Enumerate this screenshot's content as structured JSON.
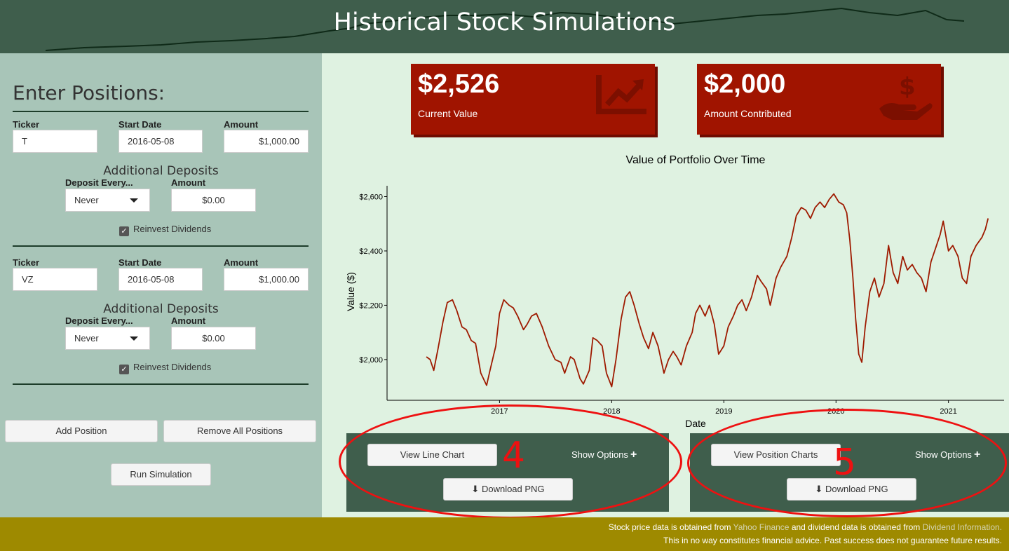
{
  "header": {
    "title": "Historical Stock Simulations"
  },
  "sidebar": {
    "heading": "Enter Positions:",
    "labels": {
      "ticker": "Ticker",
      "start_date": "Start Date",
      "amount": "Amount",
      "additional_deposits": "Additional Deposits",
      "deposit_every": "Deposit Every...",
      "deposit_amount": "Amount",
      "reinvest": "Reinvest Dividends"
    },
    "positions": [
      {
        "ticker": "T",
        "start_date": "2016-05-08",
        "amount": "$1,000.00",
        "deposit_every": "Never",
        "deposit_amount": "$0.00",
        "reinvest": true
      },
      {
        "ticker": "VZ",
        "start_date": "2016-05-08",
        "amount": "$1,000.00",
        "deposit_every": "Never",
        "deposit_amount": "$0.00",
        "reinvest": true
      }
    ],
    "add_position": "Add Position",
    "remove_all": "Remove All Positions",
    "run": "Run Simulation"
  },
  "value_boxes": [
    {
      "value": "$2,526",
      "caption": "Current Value",
      "icon": "chart-line-icon"
    },
    {
      "value": "$2,000",
      "caption": "Amount Contributed",
      "icon": "hand-holding-dollar-icon"
    }
  ],
  "chart_data": {
    "type": "line",
    "title": "Value of Portfolio Over Time",
    "xlabel": "Date",
    "ylabel": "Value ($)",
    "xticks": [
      "2017",
      "2018",
      "2019",
      "2020",
      "2021"
    ],
    "yticks": [
      "$2,000",
      "$2,200",
      "$2,400",
      "$2,600"
    ],
    "ylim": [
      1850,
      2640
    ],
    "xlim": [
      "2016-01-01",
      "2021-07-01"
    ],
    "color": "#9e1a00",
    "series": [
      {
        "points": [
          [
            "2016-05-08",
            2010
          ],
          [
            "2016-05-20",
            2000
          ],
          [
            "2016-06-01",
            1960
          ],
          [
            "2016-06-15",
            2040
          ],
          [
            "2016-07-01",
            2140
          ],
          [
            "2016-07-15",
            2210
          ],
          [
            "2016-08-01",
            2220
          ],
          [
            "2016-08-15",
            2180
          ],
          [
            "2016-09-01",
            2120
          ],
          [
            "2016-09-15",
            2110
          ],
          [
            "2016-10-01",
            2070
          ],
          [
            "2016-10-15",
            2060
          ],
          [
            "2016-11-01",
            1950
          ],
          [
            "2016-11-20",
            1905
          ],
          [
            "2016-12-01",
            1960
          ],
          [
            "2016-12-20",
            2050
          ],
          [
            "2017-01-01",
            2170
          ],
          [
            "2017-01-15",
            2220
          ],
          [
            "2017-02-01",
            2200
          ],
          [
            "2017-02-15",
            2190
          ],
          [
            "2017-03-01",
            2160
          ],
          [
            "2017-03-20",
            2110
          ],
          [
            "2017-04-01",
            2130
          ],
          [
            "2017-04-15",
            2160
          ],
          [
            "2017-05-01",
            2170
          ],
          [
            "2017-05-20",
            2120
          ],
          [
            "2017-06-10",
            2050
          ],
          [
            "2017-07-01",
            2000
          ],
          [
            "2017-07-20",
            1990
          ],
          [
            "2017-08-01",
            1950
          ],
          [
            "2017-08-20",
            2010
          ],
          [
            "2017-09-01",
            2000
          ],
          [
            "2017-09-20",
            1930
          ],
          [
            "2017-10-01",
            1910
          ],
          [
            "2017-10-20",
            1960
          ],
          [
            "2017-11-01",
            2080
          ],
          [
            "2017-11-15",
            2070
          ],
          [
            "2017-12-01",
            2050
          ],
          [
            "2017-12-15",
            1950
          ],
          [
            "2018-01-01",
            1900
          ],
          [
            "2018-01-15",
            2000
          ],
          [
            "2018-02-01",
            2150
          ],
          [
            "2018-02-15",
            2230
          ],
          [
            "2018-03-01",
            2250
          ],
          [
            "2018-03-15",
            2200
          ],
          [
            "2018-04-01",
            2130
          ],
          [
            "2018-04-15",
            2080
          ],
          [
            "2018-05-01",
            2040
          ],
          [
            "2018-05-15",
            2100
          ],
          [
            "2018-06-01",
            2050
          ],
          [
            "2018-06-20",
            1950
          ],
          [
            "2018-07-05",
            2000
          ],
          [
            "2018-07-20",
            2030
          ],
          [
            "2018-08-01",
            2010
          ],
          [
            "2018-08-15",
            1980
          ],
          [
            "2018-09-01",
            2050
          ],
          [
            "2018-09-20",
            2100
          ],
          [
            "2018-10-01",
            2170
          ],
          [
            "2018-10-15",
            2200
          ],
          [
            "2018-11-01",
            2160
          ],
          [
            "2018-11-15",
            2200
          ],
          [
            "2018-12-01",
            2130
          ],
          [
            "2018-12-15",
            2020
          ],
          [
            "2019-01-01",
            2050
          ],
          [
            "2019-01-15",
            2120
          ],
          [
            "2019-02-01",
            2160
          ],
          [
            "2019-02-15",
            2200
          ],
          [
            "2019-03-01",
            2220
          ],
          [
            "2019-03-15",
            2180
          ],
          [
            "2019-04-01",
            2230
          ],
          [
            "2019-04-20",
            2310
          ],
          [
            "2019-05-01",
            2290
          ],
          [
            "2019-05-20",
            2260
          ],
          [
            "2019-06-01",
            2200
          ],
          [
            "2019-06-20",
            2300
          ],
          [
            "2019-07-05",
            2340
          ],
          [
            "2019-07-25",
            2380
          ],
          [
            "2019-08-10",
            2450
          ],
          [
            "2019-08-25",
            2530
          ],
          [
            "2019-09-10",
            2560
          ],
          [
            "2019-09-25",
            2550
          ],
          [
            "2019-10-10",
            2520
          ],
          [
            "2019-10-25",
            2560
          ],
          [
            "2019-11-10",
            2580
          ],
          [
            "2019-11-25",
            2560
          ],
          [
            "2019-12-10",
            2590
          ],
          [
            "2019-12-25",
            2610
          ],
          [
            "2020-01-10",
            2580
          ],
          [
            "2020-01-25",
            2570
          ],
          [
            "2020-02-05",
            2540
          ],
          [
            "2020-02-15",
            2440
          ],
          [
            "2020-02-25",
            2300
          ],
          [
            "2020-03-05",
            2150
          ],
          [
            "2020-03-15",
            2020
          ],
          [
            "2020-03-25",
            1990
          ],
          [
            "2020-04-05",
            2120
          ],
          [
            "2020-04-20",
            2250
          ],
          [
            "2020-05-05",
            2300
          ],
          [
            "2020-05-20",
            2230
          ],
          [
            "2020-06-05",
            2280
          ],
          [
            "2020-06-20",
            2420
          ],
          [
            "2020-07-05",
            2320
          ],
          [
            "2020-07-20",
            2280
          ],
          [
            "2020-08-05",
            2380
          ],
          [
            "2020-08-20",
            2330
          ],
          [
            "2020-09-05",
            2350
          ],
          [
            "2020-09-20",
            2320
          ],
          [
            "2020-10-05",
            2300
          ],
          [
            "2020-10-20",
            2250
          ],
          [
            "2020-11-05",
            2360
          ],
          [
            "2020-11-20",
            2410
          ],
          [
            "2020-12-05",
            2460
          ],
          [
            "2020-12-15",
            2510
          ],
          [
            "2021-01-01",
            2400
          ],
          [
            "2021-01-15",
            2420
          ],
          [
            "2021-02-01",
            2380
          ],
          [
            "2021-02-15",
            2300
          ],
          [
            "2021-03-01",
            2280
          ],
          [
            "2021-03-15",
            2380
          ],
          [
            "2021-04-01",
            2420
          ],
          [
            "2021-04-20",
            2450
          ],
          [
            "2021-05-01",
            2480
          ],
          [
            "2021-05-10",
            2520
          ]
        ]
      }
    ]
  },
  "panels": {
    "line": {
      "view_button": "View Line Chart",
      "show_options": "Show Options",
      "download": "Download PNG",
      "annotation": "4"
    },
    "position": {
      "view_button": "View Position Charts",
      "show_options": "Show Options",
      "download": "Download PNG",
      "annotation": "5"
    }
  },
  "footer": {
    "line1_prefix": "Stock price data is obtained from ",
    "yahoo": "Yahoo Finance",
    "line1_mid": " and dividend data is obtained from ",
    "dividend": "Dividend Information.",
    "line2": "This in no way constitutes financial advice. Past success does not guarantee future results."
  },
  "colors": {
    "header": "#3f5e4c",
    "sidebar": "#a8c5b8",
    "main_bg": "#dff2e1",
    "value_box": "#a01400",
    "line": "#9e1a00",
    "footer": "#9e8a00",
    "annotation": "#ee1111"
  }
}
